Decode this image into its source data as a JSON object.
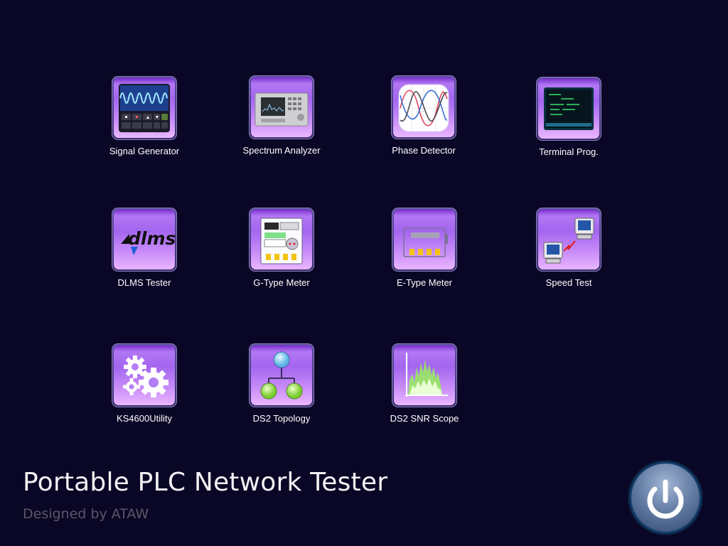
{
  "apps": [
    {
      "label": "Signal Generator",
      "icon": "signal-generator-icon"
    },
    {
      "label": "Spectrum Analyzer",
      "icon": "spectrum-analyzer-icon"
    },
    {
      "label": "Phase Detector",
      "icon": "phase-detector-icon"
    },
    {
      "label": "Terminal Prog.",
      "icon": "terminal-icon"
    },
    {
      "label": "DLMS Tester",
      "icon": "dlms-logo-icon",
      "logo_text": "dlms"
    },
    {
      "label": "G-Type Meter",
      "icon": "g-type-meter-icon"
    },
    {
      "label": "E-Type Meter",
      "icon": "e-type-meter-icon"
    },
    {
      "label": "Speed Test",
      "icon": "computers-link-icon"
    },
    {
      "label": "KS4600Utility",
      "icon": "gears-icon"
    },
    {
      "label": "DS2 Topology",
      "icon": "topology-tree-icon"
    },
    {
      "label": "DS2 SNR Scope",
      "icon": "snr-chart-icon"
    }
  ],
  "footer": {
    "title": "Portable PLC Network Tester",
    "subtitle": "Designed by ATAW"
  },
  "power_button": {
    "icon": "power-icon"
  },
  "colors": {
    "background": "#0a0726",
    "tile_purple": "#b07af3",
    "power_blue": "#4f6b96"
  }
}
